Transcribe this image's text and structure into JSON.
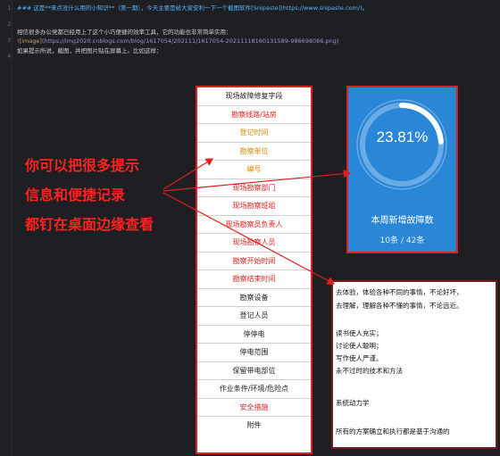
{
  "editor": {
    "line_numbers": [
      "1",
      "2",
      "3",
      "4"
    ],
    "lines": [
      {
        "header": "### 这是**来点没什么用的小知识**（第一期），今天主要是给大家安利一下一个截图软件[Snipaste](https://www.snipaste.com/)。"
      },
      {
        "text": "相信很多办公党都已经用上了这个小巧便捷的效率工具，它的功能也非常简单实用："
      },
      {
        "img": "![image]",
        "link": "(https://img2020.cnblogs.com/blog/1617054/202111/1617054-20211118160131589-986698086.png)"
      },
      {
        "text": "如果提示所说，截图，并把图片贴在屏幕上。比如这样："
      }
    ]
  },
  "table_rows": [
    {
      "label": "现场故障修复字段",
      "color": "#222222"
    },
    {
      "label": "勘察线路/站房",
      "color": "#e0201f"
    },
    {
      "label": "登记时间",
      "color": "#e08a00"
    },
    {
      "label": "勘察单位",
      "color": "#e08a00"
    },
    {
      "label": "编号",
      "color": "#e08a00"
    },
    {
      "label": "现场勘察部门",
      "color": "#e0201f"
    },
    {
      "label": "现场勘察班组",
      "color": "#e0201f"
    },
    {
      "label": "现场勘察员负责人",
      "color": "#e0201f"
    },
    {
      "label": "现场勘察人员",
      "color": "#e0201f"
    },
    {
      "label": "勘察开始时间",
      "color": "#e0201f"
    },
    {
      "label": "勘察结束时间",
      "color": "#e0201f"
    },
    {
      "label": "勘察设备",
      "color": "#222222"
    },
    {
      "label": "登记人员",
      "color": "#222222"
    },
    {
      "label": "停停电",
      "color": "#222222"
    },
    {
      "label": "停电范围",
      "color": "#222222"
    },
    {
      "label": "保留带电部位",
      "color": "#222222"
    },
    {
      "label": "作业条件/环境/危险点",
      "color": "#222222"
    },
    {
      "label": "安全措施",
      "color": "#e0201f"
    },
    {
      "label": "附件",
      "color": "#222222"
    }
  ],
  "gauge": {
    "percent_text": "23.81%",
    "fraction": 0.2381,
    "title": "本周新增故障数",
    "count": "10条 / 42条"
  },
  "callout": {
    "lines": [
      "你可以把很多提示",
      "信息和便捷记录",
      "都钉在桌面边缘查看"
    ]
  },
  "note": {
    "lines": [
      "去体验，体验各种不同的事情，不论好坏，",
      "去理解，理解各种不懂的事情，不论远近。",
      "",
      "读书使人充实；",
      "讨论使人聪明；",
      "写作使人严谨。",
      "永不过时的技术和方法",
      "",
      "系统动力学",
      "",
      "所有的方案确立和执行都是基于沟通的"
    ]
  },
  "colors": {
    "accent_red": "#e0201f",
    "card_blue": "#2a87d8",
    "editor_bg": "#1e1f22"
  }
}
